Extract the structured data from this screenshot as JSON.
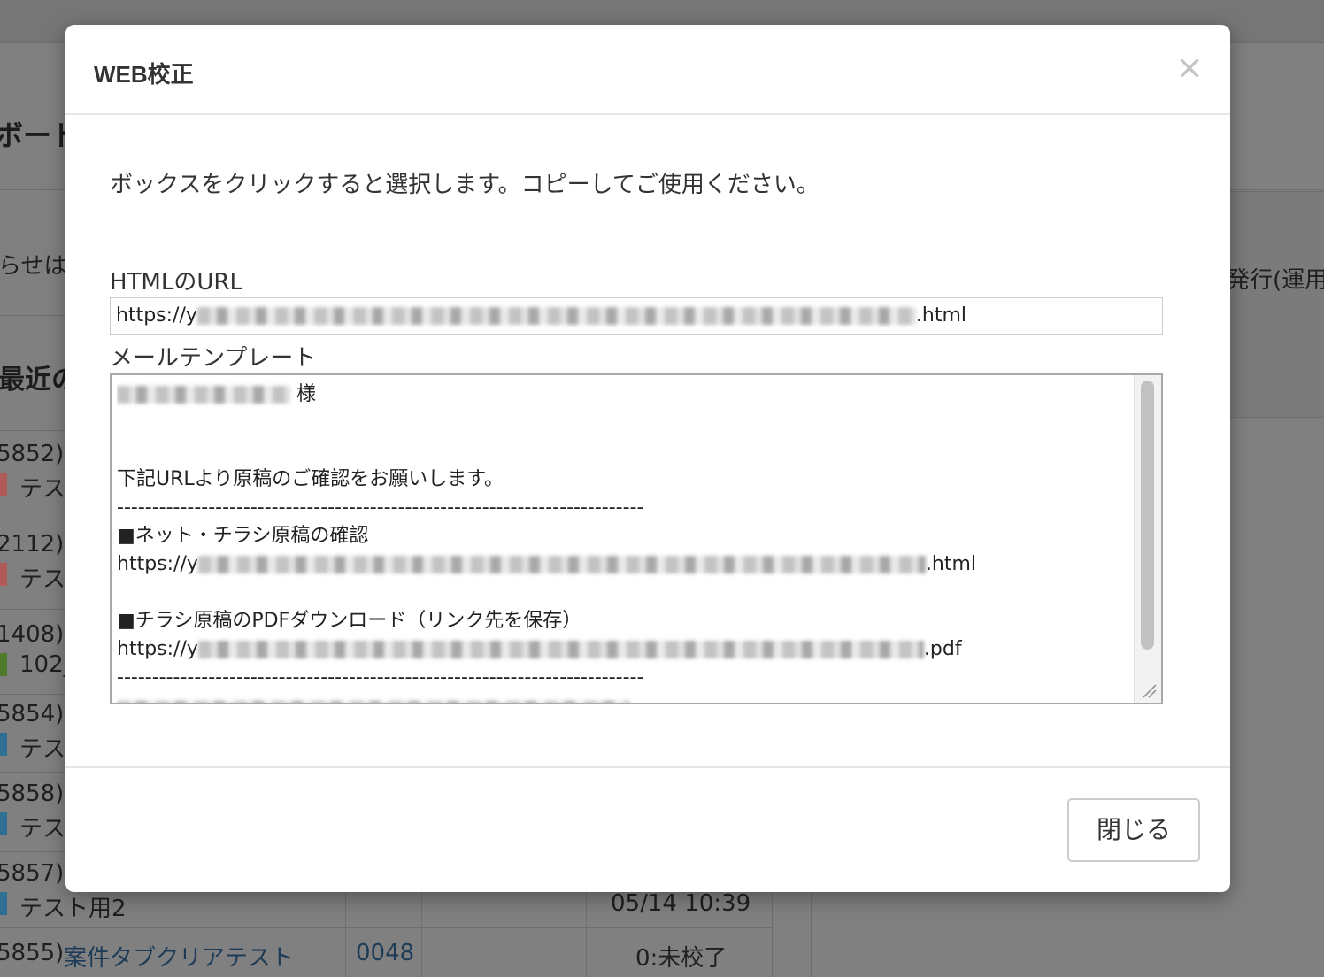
{
  "background": {
    "heading_fragments": [
      "ボード",
      "最近の"
    ],
    "notice_fragment": "らせは",
    "right_fragment": "発行(運用",
    "rows": [
      {
        "id": "5852)",
        "sub": "テス",
        "tag_color": "#b05a5a"
      },
      {
        "id": "2112)",
        "sub": "テス",
        "tag_color": "#b05a5a"
      },
      {
        "id": "1408)",
        "sub": "102_",
        "tag_color": "#4f7a2a"
      },
      {
        "id": "5854)",
        "sub": "テス",
        "tag_color": "#2f6f94"
      },
      {
        "id": "5858)",
        "sub": "テス",
        "tag_color": "#2f6f94"
      },
      {
        "id": "5857)",
        "sub": "テスト用2",
        "tag_color": "#2f6f94"
      }
    ],
    "bottom_row": {
      "id": "5855)",
      "title": "案件タブクリアテスト",
      "code": "0048",
      "status": "0:未校了",
      "time": "05/14 10:39"
    }
  },
  "modal": {
    "title": "WEB校正",
    "close_icon": "×",
    "instruction": "ボックスをクリックすると選択します。コピーしてご使用ください。",
    "html_url_label": "HTMLのURL",
    "html_url_prefix": "https://y",
    "html_url_suffix": ".html",
    "mail_template_label": "メールテンプレート",
    "mail": {
      "salutation_suffix": "様",
      "line_request": "下記URLより原稿のご確認をお願いします。",
      "divider": "---------------------------------------------------------------------------",
      "section1_title": "■ネット・チラシ原稿の確認",
      "section1_url_prefix": "https://y",
      "section1_url_suffix": ".html",
      "section2_title": "■チラシ原稿のPDFダウンロード（リンク先を保存）",
      "section2_url_prefix": "https://y",
      "section2_url_suffix": ".pdf"
    },
    "footer_close_label": "閉じる"
  }
}
